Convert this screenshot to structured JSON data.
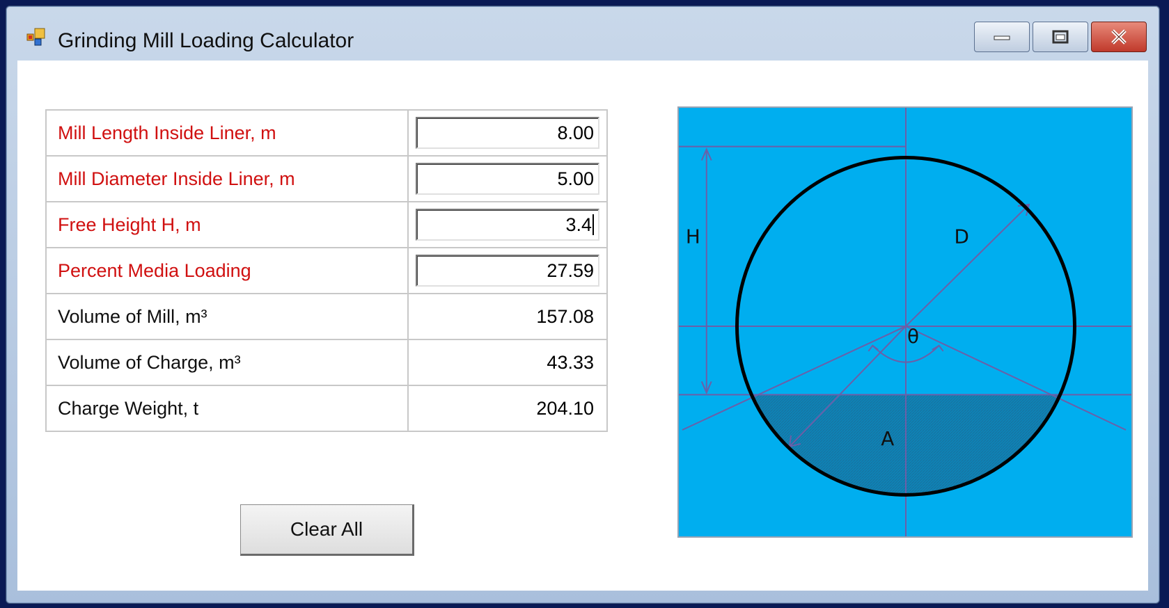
{
  "window": {
    "title": "Grinding Mill Loading Calculator",
    "app_icon": "windows-forms-app-icon"
  },
  "titlebar_buttons": [
    "minimize-icon",
    "maximize-icon",
    "close-icon"
  ],
  "rows": [
    {
      "label": "Mill Length Inside Liner, m",
      "value": "8.00",
      "type": "input"
    },
    {
      "label": "Mill Diameter Inside Liner, m",
      "value": "5.00",
      "type": "input"
    },
    {
      "label": "Free Height H, m",
      "value": "3.4",
      "type": "input"
    },
    {
      "label": "Percent Media Loading",
      "value": "27.59",
      "type": "input"
    },
    {
      "label": "Volume of Mill, m³",
      "value": "157.08",
      "type": "output"
    },
    {
      "label": "Volume of Charge, m³",
      "value": "43.33",
      "type": "output"
    },
    {
      "label": "Charge Weight, t",
      "value": "204.10",
      "type": "output"
    }
  ],
  "clear_button": "Clear All",
  "diagram": {
    "labels": {
      "height": "H",
      "diameter": "D",
      "angle": "θ",
      "area": "A"
    },
    "colors": {
      "background": "#00aeef",
      "circle": "#000000",
      "lines": "#6b5fa8",
      "charge": "#0c7fb0"
    }
  }
}
